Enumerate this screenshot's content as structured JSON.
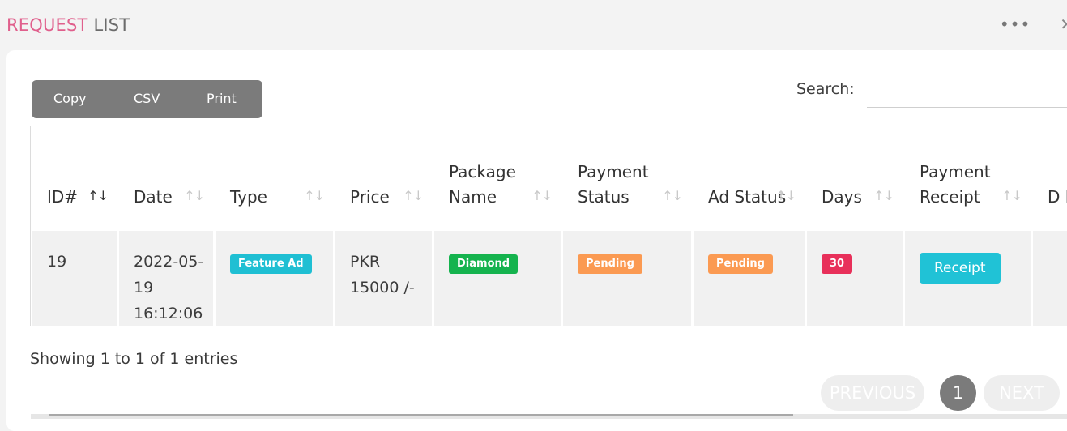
{
  "header": {
    "title_accent": "REQUEST",
    "title_rest": " LIST",
    "more_icon": "•••",
    "close_icon": "✕"
  },
  "toolbar": {
    "copy_label": "Copy",
    "csv_label": "CSV",
    "print_label": "Print"
  },
  "search": {
    "label": "Search:",
    "value": ""
  },
  "table": {
    "columns": [
      "ID#",
      "Date",
      "Type",
      "Price",
      "Package Name",
      "Payment Status",
      "Ad Status",
      "Days",
      "Payment Receipt",
      "D P"
    ],
    "sort_icon": "↑↓",
    "rows": [
      {
        "id": "19",
        "date": "2022-05-19 16:12:06",
        "type": "Feature Ad",
        "price": "PKR 15000 /-",
        "package": "Diamond",
        "payment_status": "Pending",
        "ad_status": "Pending",
        "days": "30",
        "receipt": "Receipt"
      }
    ]
  },
  "footer": {
    "info": "Showing 1 to 1 of 1 entries",
    "previous": "PREVIOUS",
    "current_page": "1",
    "next": "NEXT"
  },
  "colors": {
    "accent": "#e05f8c",
    "badge_cyan": "#1fbfd3",
    "badge_green": "#15b34e",
    "badge_orange": "#fb9a52",
    "badge_red": "#e8305a"
  }
}
